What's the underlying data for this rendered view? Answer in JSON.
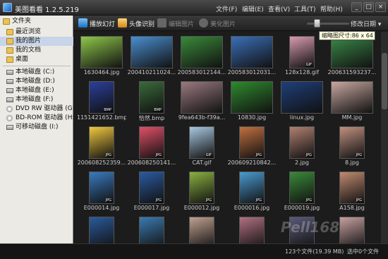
{
  "app": {
    "title": "美图看看 1.2.5.219"
  },
  "menu": [
    "文件(F)",
    "编辑(E)",
    "查看(V)",
    "工具(T)",
    "帮助(H)"
  ],
  "window_buttons": [
    "_",
    "□",
    "×"
  ],
  "sidebar": {
    "header": "文件夹",
    "items": [
      {
        "label": "最近浏览",
        "icon": "folder-icon",
        "selected": false
      },
      {
        "label": "我的图片",
        "icon": "folder-icon",
        "selected": true
      },
      {
        "label": "我的文档",
        "icon": "folder-icon",
        "selected": false
      },
      {
        "label": "桌面",
        "icon": "folder-icon",
        "selected": false
      }
    ],
    "drives": [
      {
        "label": "本地磁盘 (C:)",
        "icon": "drive-icon"
      },
      {
        "label": "本地磁盘 (D:)",
        "icon": "drive-icon"
      },
      {
        "label": "本地磁盘 (E:)",
        "icon": "drive-icon"
      },
      {
        "label": "本地磁盘 (F:)",
        "icon": "drive-icon"
      },
      {
        "label": "DVD RW 驱动器 (G:)",
        "icon": "cd-icon"
      },
      {
        "label": "BD-ROM 驱动器 (H:)",
        "icon": "cd-icon"
      },
      {
        "label": "可移动磁盘 (I:)",
        "icon": "drive-icon"
      }
    ]
  },
  "toolbar": {
    "slideshow": "播放幻灯",
    "face_detect": "头像识别",
    "edit": "编辑图片",
    "beautify": "美化图片",
    "sort": "修改日期",
    "tooltip": "缩略图尺寸:86 x 64"
  },
  "thumbnails": [
    {
      "name": "1630464.jpg",
      "color": "#8fc84a"
    },
    {
      "name": "200410211024...",
      "color": "#4a8fd0"
    },
    {
      "name": "200583012144...",
      "color": "#3a8a3a"
    },
    {
      "name": "200583012031...",
      "color": "#3b6fb8"
    },
    {
      "name": "128x128.gif",
      "color": "#d89ab0",
      "portrait": true,
      "badge": "GIF"
    },
    {
      "name": "200631593237...",
      "color": "#3a8a48"
    },
    {
      "name": "1151421652.bmp",
      "color": "#2b3f9a",
      "portrait": true,
      "badge": "BMP"
    },
    {
      "name": "恰然.bmp",
      "color": "#3a6a3a",
      "portrait": true,
      "badge": "BMP"
    },
    {
      "name": "9fea643b-f39a...",
      "color": "#9a7a80"
    },
    {
      "name": "10830.jpg",
      "color": "#2f8a2f"
    },
    {
      "name": "linux.jpg",
      "color": "#1f3f7a"
    },
    {
      "name": "MM.jpg",
      "color": "#c8a8a0"
    },
    {
      "name": "200608252359...",
      "color": "#f0c840",
      "portrait": true,
      "badge": "JPG"
    },
    {
      "name": "200608250141...",
      "color": "#e05068",
      "portrait": true,
      "badge": "JPG"
    },
    {
      "name": "CAT.gif",
      "color": "#a8c8e0",
      "portrait": true,
      "badge": "GIF"
    },
    {
      "name": "200609210842...",
      "color": "#c07040",
      "portrait": true,
      "badge": "JPG"
    },
    {
      "name": "2.jpg",
      "color": "#b08070",
      "portrait": true,
      "badge": "JPG"
    },
    {
      "name": "8.jpg",
      "color": "#c09080",
      "portrait": true,
      "badge": "JPG"
    },
    {
      "name": "E000014.jpg",
      "color": "#3a7ac0",
      "portrait": true,
      "badge": "JPG"
    },
    {
      "name": "E000017.jpg",
      "color": "#2a5aa0",
      "portrait": true,
      "badge": "JPG"
    },
    {
      "name": "E000012.jpg",
      "color": "#8ab040",
      "portrait": true,
      "badge": "JPG"
    },
    {
      "name": "E000016.jpg",
      "color": "#4a9ad0",
      "portrait": true,
      "badge": "JPG"
    },
    {
      "name": "E000019.jpg",
      "color": "#3a8a3a",
      "portrait": true,
      "badge": "JPG"
    },
    {
      "name": "A158.jpg",
      "color": "#c08a70",
      "portrait": true,
      "badge": "JPG"
    },
    {
      "name": "",
      "color": "#2a5a9a",
      "portrait": true
    },
    {
      "name": "",
      "color": "#3a7ab0",
      "portrait": true
    },
    {
      "name": "",
      "color": "#c0a090",
      "portrait": true
    },
    {
      "name": "",
      "color": "#b07080",
      "portrait": true
    },
    {
      "name": "",
      "color": "#5a5a7a",
      "portrait": true
    },
    {
      "name": "",
      "color": "#c8a0a0",
      "portrait": true
    }
  ],
  "status": {
    "count": "123个文件(19.39 MB)",
    "selected": "选中0个文件"
  },
  "watermark": "Pell168"
}
